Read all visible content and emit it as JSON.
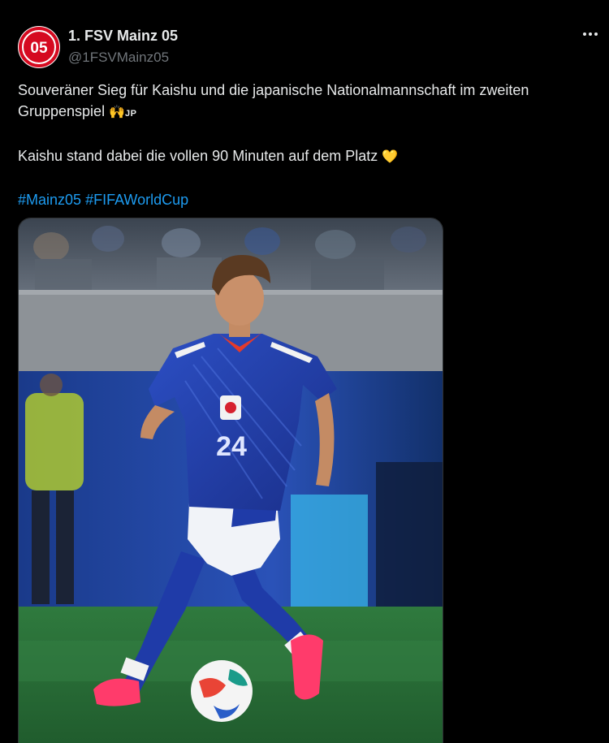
{
  "account": {
    "display_name": "1. FSV Mainz 05",
    "handle": "@1FSVMainz05",
    "logo_text": "05"
  },
  "tweet": {
    "line1": "Souveräner Sieg für Kaishu und die japanische Nationalmannschaft im zweiten Gruppenspiel",
    "line1_emoji": "🙌",
    "line1_flag": "JP",
    "line2": "Kaishu stand dabei die vollen 90 Minuten auf dem Platz",
    "line2_emoji": "💛",
    "hashtags": [
      "#Mainz05",
      "#FIFAWorldCup"
    ]
  },
  "media": {
    "jersey_number": "24",
    "icon": "photo-football-player"
  },
  "colors": {
    "background": "#000000",
    "text": "#e7e9ea",
    "secondary": "#71767b",
    "link": "#1d9bf0",
    "brand_red": "#d50a20"
  }
}
